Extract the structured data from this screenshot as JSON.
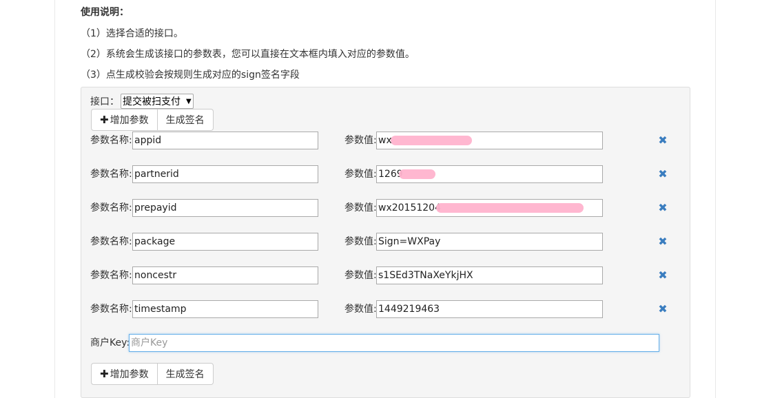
{
  "usage": {
    "title": "使用说明：",
    "lines": [
      "（1）选择合适的接口。",
      "（2）系统会生成该接口的参数表，您可以直接在文本框内填入对应的参数值。",
      "（3）点生成校验会按规则生成对应的sign签名字段"
    ]
  },
  "interface": {
    "label": "接口：",
    "selected": "提交被扫支付"
  },
  "buttons": {
    "add_param": "增加参数",
    "generate_sign": "生成签名"
  },
  "params": {
    "name_label": "参数名称:",
    "value_label": "参数值:",
    "rows": [
      {
        "name": "appid",
        "value": "wx"
      },
      {
        "name": "partnerid",
        "value": "1269"
      },
      {
        "name": "prepayid",
        "value": "wx20151204"
      },
      {
        "name": "package",
        "value": "Sign=WXPay"
      },
      {
        "name": "noncestr",
        "value": "s1SEd3TNaXeYkjHX"
      },
      {
        "name": "timestamp",
        "value": "1449219463"
      }
    ]
  },
  "merchant_key": {
    "label": "商户Key:",
    "placeholder": "商户Key"
  },
  "colors": {
    "panel_bg": "#f5f5f5",
    "remove_icon": "#3a7dbf",
    "focus_border": "#66afe9",
    "redaction": "#ffb3cd"
  },
  "icons": {
    "add": "plus-icon",
    "remove": "remove-icon",
    "dropdown": "caret-down-icon"
  }
}
